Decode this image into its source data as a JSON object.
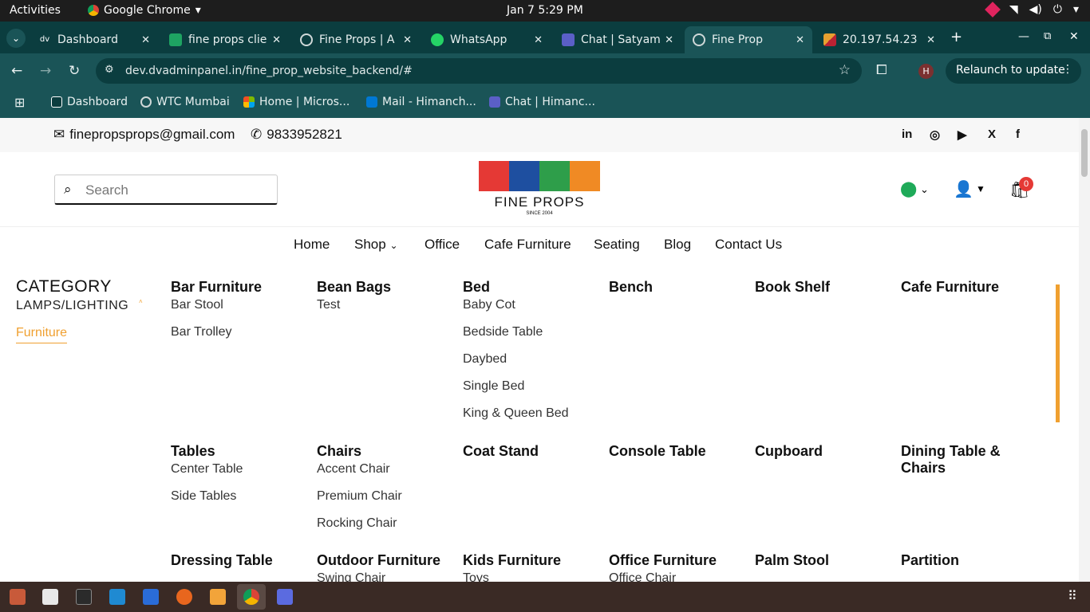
{
  "system": {
    "activities": "Activities",
    "app_name": "Google Chrome",
    "clock": "Jan 7   5:29 PM"
  },
  "tabs": [
    {
      "title": "Dashboard",
      "color": "#ffffff"
    },
    {
      "title": "fine props clie",
      "color": "#1ea362"
    },
    {
      "title": "Fine Props | A",
      "color": "#cfd8d8"
    },
    {
      "title": "WhatsApp",
      "color": "#25d366"
    },
    {
      "title": "Chat | Satyam",
      "color": "#5b5fc7"
    },
    {
      "title": "Fine Prop",
      "color": "#cfd8d8"
    },
    {
      "title": "20.197.54.23",
      "color": "#e8a030"
    }
  ],
  "omnibar": {
    "url": "dev.dvadminpanel.in/fine_prop_website_backend/#",
    "avatar_letter": "H",
    "relaunch": "Relaunch to update"
  },
  "bookmarks": [
    {
      "label": "Dashboard",
      "color": "#ffffff"
    },
    {
      "label": "WTC Mumbai",
      "color": "#cfd8d8"
    },
    {
      "label": "Home | Micros...",
      "color": "#f25022"
    },
    {
      "label": "Mail - Himanch...",
      "color": "#0078d4"
    },
    {
      "label": "Chat | Himanc...",
      "color": "#5b5fc7"
    }
  ],
  "topstrip": {
    "email": "finepropsprops@gmail.com",
    "phone": "9833952821",
    "social": [
      "in",
      "◎",
      "▶",
      "X",
      "f"
    ]
  },
  "header": {
    "search_placeholder": "Search",
    "logo_name": "FINE PROPS",
    "logo_since": "SINCE 2004",
    "cart_count": "0",
    "logo_colors": [
      "#e53935",
      "#1e4fa0",
      "#2e9e4a",
      "#f08a24"
    ]
  },
  "nav": [
    "Home",
    "Shop",
    "Office",
    "Cafe Furniture",
    "Seating",
    "Blog",
    "Contact Us"
  ],
  "category": {
    "heading": "CATEGORY",
    "lamps": "LAMPS/LIGHTING",
    "furniture": "Furniture"
  },
  "mega": {
    "row1": [
      {
        "head": "Bar Furniture",
        "subs": [
          "Bar Stool",
          "Bar Trolley"
        ]
      },
      {
        "head": "Bean Bags",
        "subs": [
          "Test"
        ]
      },
      {
        "head": "Bed",
        "subs": [
          "Baby Cot",
          "Bedside Table",
          "Daybed",
          "Single Bed",
          "King & Queen Bed"
        ]
      },
      {
        "head": "Bench",
        "subs": []
      },
      {
        "head": "Book Shelf",
        "subs": []
      },
      {
        "head": "Cafe Furniture",
        "subs": []
      }
    ],
    "row2": [
      {
        "head": "Tables",
        "subs": [
          "Center Table",
          "Side Tables"
        ]
      },
      {
        "head": "Chairs",
        "subs": [
          "Accent Chair",
          "Premium Chair",
          "Rocking Chair"
        ]
      },
      {
        "head": "Coat Stand",
        "subs": []
      },
      {
        "head": "Console Table",
        "subs": []
      },
      {
        "head": "Cupboard",
        "subs": []
      },
      {
        "head": "Dining Table & Chairs",
        "subs": []
      }
    ],
    "row3": [
      {
        "head": "Dressing Table",
        "subs": []
      },
      {
        "head": "Outdoor Furniture",
        "subs": [
          "Swing Chair"
        ]
      },
      {
        "head": "Kids Furniture",
        "subs": [
          "Toys"
        ]
      },
      {
        "head": "Office Furniture",
        "subs": [
          "Office Chair"
        ]
      },
      {
        "head": "Palm Stool",
        "subs": []
      },
      {
        "head": "Partition",
        "subs": []
      }
    ]
  }
}
